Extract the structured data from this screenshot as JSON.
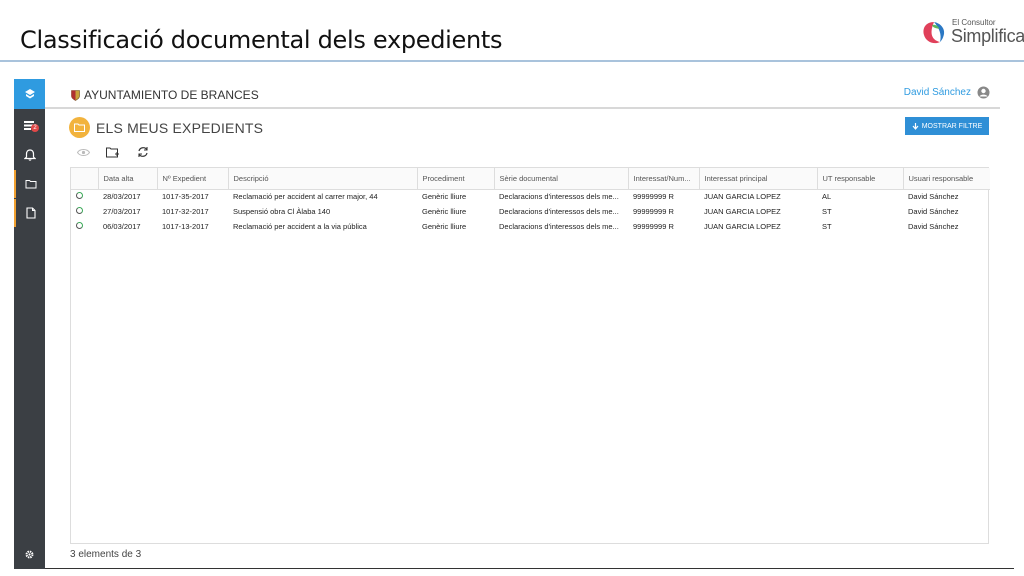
{
  "slide": {
    "title": "Classificació documental dels expedients"
  },
  "logo": {
    "small": "El Consultor",
    "big": "Simplifica"
  },
  "sidebar": {
    "badge": "2",
    "items": [
      {
        "icon": "home-icon"
      },
      {
        "icon": "inbox-icon"
      },
      {
        "icon": "bell-icon"
      },
      {
        "icon": "folder-icon"
      },
      {
        "icon": "document-icon"
      },
      {
        "icon": "gear-icon"
      }
    ]
  },
  "topbar": {
    "organization": "AYUNTAMIENTO DE BRANCES",
    "user_name": "David Sánchez"
  },
  "page": {
    "title": "ELS MEUS EXPEDIENTS",
    "filter_button": "MOSTRAR FILTRE"
  },
  "toolbar": [
    "eye-icon",
    "new-folder-icon",
    "refresh-icon"
  ],
  "table": {
    "columns": [
      "",
      "Data alta",
      "Nº Expedient",
      "Descripció",
      "Procediment",
      "Sèrie documental",
      "Interessat/Num...",
      "Interessat principal",
      "UT responsable",
      "Usuari responsable"
    ],
    "rows": [
      [
        "28/03/2017",
        "1017-35-2017",
        "Reclamació per accident al carrer major, 44",
        "Genèric lliure",
        "Declaracions d'interessos dels me...",
        "99999999 R",
        "JUAN GARCIA LOPEZ",
        "AL",
        "David Sánchez"
      ],
      [
        "27/03/2017",
        "1017-32-2017",
        "Suspensió obra Cl Àlaba 140",
        "Genèric lliure",
        "Declaracions d'interessos dels me...",
        "99999999 R",
        "JUAN GARCIA LOPEZ",
        "ST",
        "David Sánchez"
      ],
      [
        "06/03/2017",
        "1017-13-2017",
        "Reclamació per accident a la via pública",
        "Genèric lliure",
        "Declaracions d'interessos dels me...",
        "99999999 R",
        "JUAN GARCIA LOPEZ",
        "ST",
        "David Sánchez"
      ]
    ]
  },
  "footer": {
    "count_text": "3 elements de 3"
  },
  "colors": {
    "accent": "#2f9be0",
    "sidebar": "#3b3f44",
    "folder": "#f2b33d",
    "status_green": "#3aa857"
  }
}
